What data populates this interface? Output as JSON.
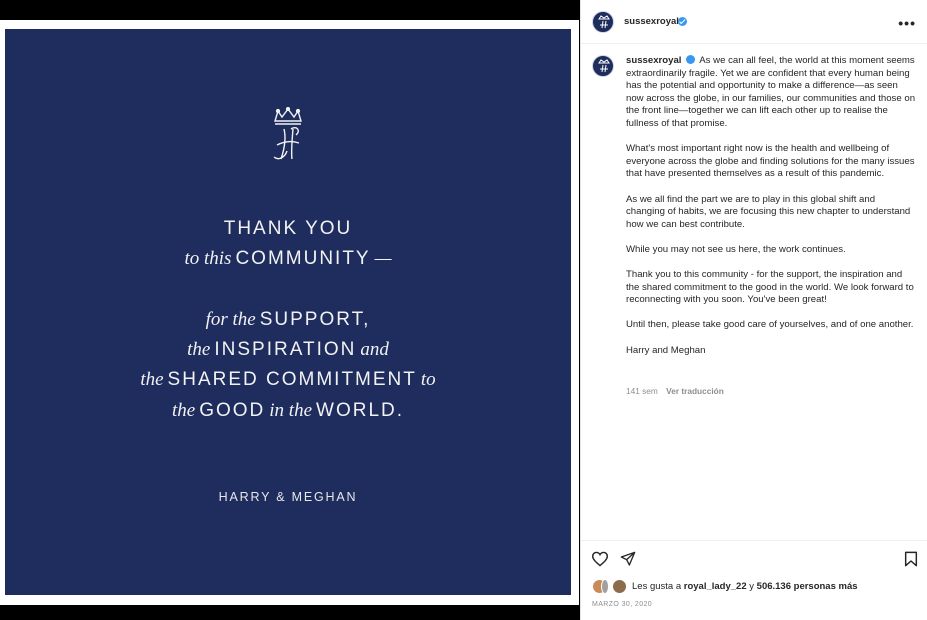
{
  "post": {
    "image": {
      "line1_caps": "THANK YOU",
      "line2_ital": "to this",
      "line2_caps": "COMMUNITY",
      "line2_dash": "—",
      "line3_ital": "for the",
      "line3_caps": "SUPPORT,",
      "line4_ital_a": "the",
      "line4_caps": "INSPIRATION",
      "line4_ital_b": "and",
      "line5_ital_a": "the",
      "line5_caps": "SHARED COMMITMENT",
      "line5_ital_b": "to",
      "line6_ital_a": "the",
      "line6_caps_a": "GOOD",
      "line6_ital_b": "in the",
      "line6_caps_b": "WORLD.",
      "signature": "HARRY & MEGHAN",
      "background_color": "#1e2d5e"
    }
  },
  "header": {
    "username": "sussexroyal",
    "more_icon": "more-horizontal-icon"
  },
  "caption": {
    "username": "sussexroyal",
    "paragraphs": [
      "As we can all feel, the world at this moment seems extraordinarily fragile. Yet we are confident that every human being has the potential and opportunity to make a difference—as seen now across the globe, in our families, our communities and those on the front line—together we can lift each other up to realise the fullness of that promise.",
      "What's most important right now is the health and wellbeing of everyone across the globe and finding solutions for the many issues that have presented themselves as a result of this pandemic.",
      "As we all find the part we are to play in this global shift and changing of habits, we are focusing this new chapter to understand how we can best contribute.",
      "While you may not see us here, the work continues.",
      "Thank you to this community - for the support, the inspiration and the shared commitment to the good in the world. We look forward to reconnecting with you soon. You've been great!",
      "Until then, please take good care of yourselves, and of one another.",
      "Harry and Meghan"
    ],
    "age": "141 sem",
    "translate": "Ver traducción"
  },
  "actions": {
    "like_icon": "heart-icon",
    "share_icon": "send-icon",
    "save_icon": "bookmark-icon"
  },
  "likes": {
    "prefix": "Les gusta a",
    "user": "royal_lady_22",
    "connector": "y",
    "count": "506.136 personas más"
  },
  "date": "MARZO 30, 2020",
  "colors": {
    "navy": "#1e2d5e",
    "verified_blue": "#3897f0",
    "muted_text": "#8e8e8e"
  }
}
